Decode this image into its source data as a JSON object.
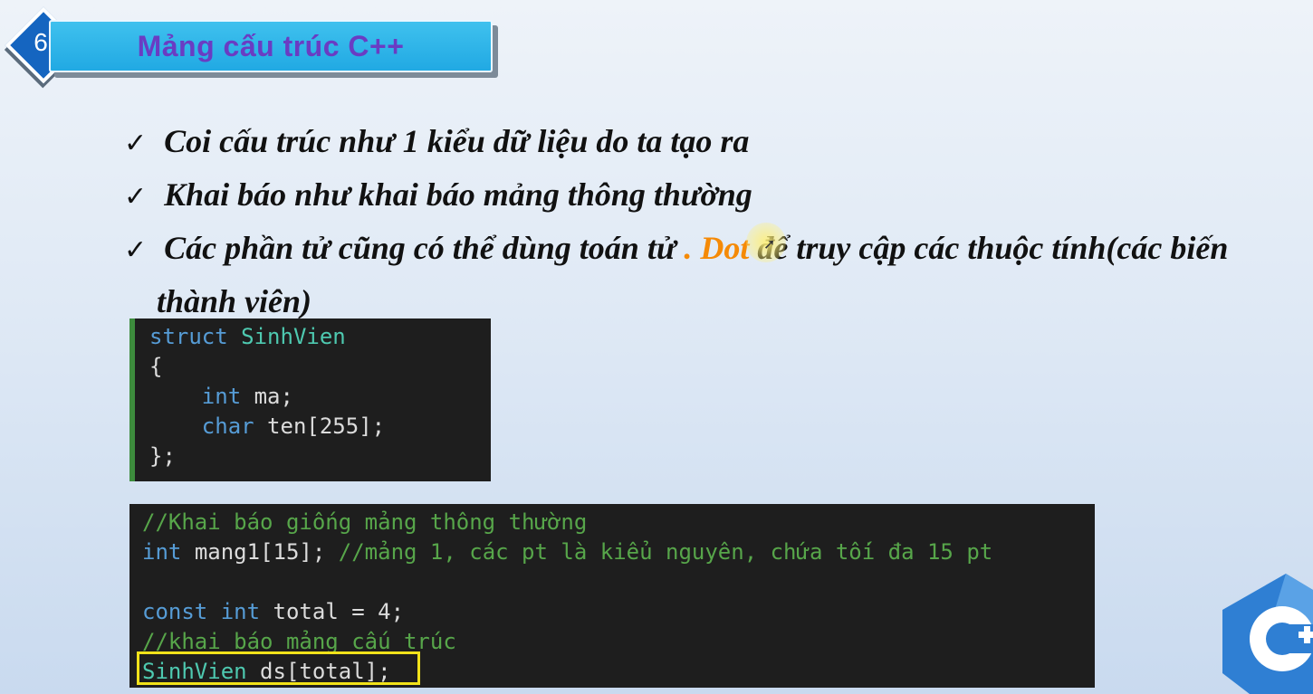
{
  "header": {
    "number": "6",
    "title": "Mảng cấu trúc C++"
  },
  "bullets": {
    "line1": "Coi cấu trúc như 1 kiểu dữ liệu do ta tạo ra",
    "line2": "Khai báo như khai báo mảng thông thường",
    "line3_pre": "Các phần tử cũng có thể dùng toán tử",
    "line3_dot": ". Dot",
    "line3_post": "để truy cập các thuộc tính(các biến",
    "line4": "thành viên)"
  },
  "code1": {
    "l1_kw": "struct",
    "l1_name": "SinhVien",
    "l2": "{",
    "l3_kw": "int",
    "l3_rest": "ma;",
    "l4_kw": "char",
    "l4_rest": "ten[255];",
    "l5": "};"
  },
  "code2": {
    "c1": "//Khai báo giống mảng thông thường",
    "l2_kw": "int",
    "l2_id": "mang1",
    "l2_rest": "[15];",
    "l2_cm": "//mảng 1, các pt là kiểu nguyên, chứa tối đa 15 pt",
    "l4_kw1": "const",
    "l4_kw2": "int",
    "l4_id": "total",
    "l4_rest": " = 4;",
    "c5": "//khai báo mảng cấu trúc",
    "l6_type": "SinhVien",
    "l6_rest": "ds[total];"
  },
  "colors": {
    "accent": "#21a9e3",
    "title": "#6a3cc3",
    "dot": "#f58a07",
    "highlight": "#f1e21a"
  },
  "icons": [
    "check-icon",
    "cpp-logo-icon"
  ]
}
